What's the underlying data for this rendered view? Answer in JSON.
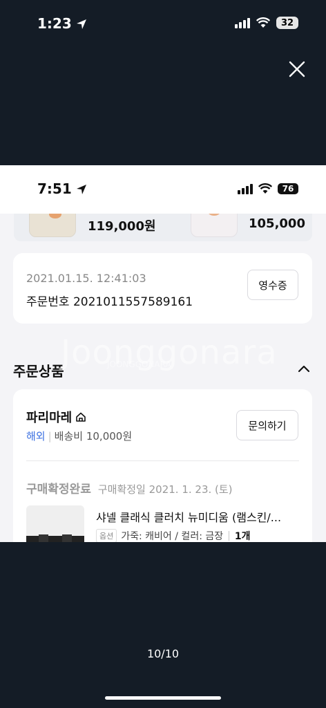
{
  "outer_status": {
    "time": "1:23",
    "battery": "32"
  },
  "inner_status": {
    "time": "7:51",
    "battery": "76"
  },
  "products": [
    {
      "price": "119,000원"
    },
    {
      "price": "105,000"
    }
  ],
  "order": {
    "datetime": "2021.01.15. 12:41:03",
    "number_label": "주문번호 2021011557589161",
    "receipt_button": "영수증"
  },
  "section": {
    "title": "주문상품"
  },
  "watermark": {
    "text": "Joonggonara",
    "sub": "JOONGGONARA"
  },
  "shop": {
    "name": "파리마레",
    "overseas": "해외",
    "shipping": "배송비 10,000원",
    "inquiry_button": "문의하기"
  },
  "item": {
    "status": "구매확정완료",
    "confirm_date": "구매확정일 2021. 1. 23. (토)",
    "title": "샤넬 클래식 클러치 뉴미디움 (램스킨/...",
    "option_badge": "옵션",
    "options": "가죽: 캐비어 / 컬러: 금장",
    "quantity": "1개"
  },
  "viewer": {
    "page_counter": "10/10"
  },
  "icons": {
    "close": "close-icon",
    "location": "location-arrow-icon",
    "wifi": "wifi-icon",
    "signal": "signal-icon",
    "home": "home-icon",
    "chevron": "chevron-up-icon"
  }
}
